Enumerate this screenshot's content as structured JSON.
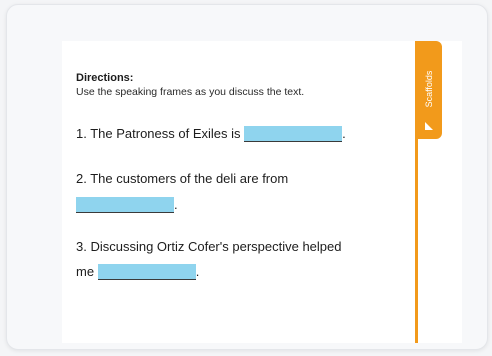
{
  "directions": {
    "title": "Directions:",
    "text": "Use the speaking frames as you discuss the text."
  },
  "frames": [
    {
      "before": "1. The Patroness of Exiles is",
      "after": "."
    },
    {
      "before": "2. The customers of the deli are from",
      "after": "."
    },
    {
      "before": "3. Discussing Ortiz Cofer's perspective helped",
      "line2_before": "me",
      "after": "."
    }
  ],
  "scaffolds_tab": {
    "label": "Scaffolds",
    "icon": "ruler-triangle-icon"
  },
  "colors": {
    "accent": "#f29a1b",
    "blank_fill": "#8fd4ee",
    "panel": "#ffffff"
  }
}
